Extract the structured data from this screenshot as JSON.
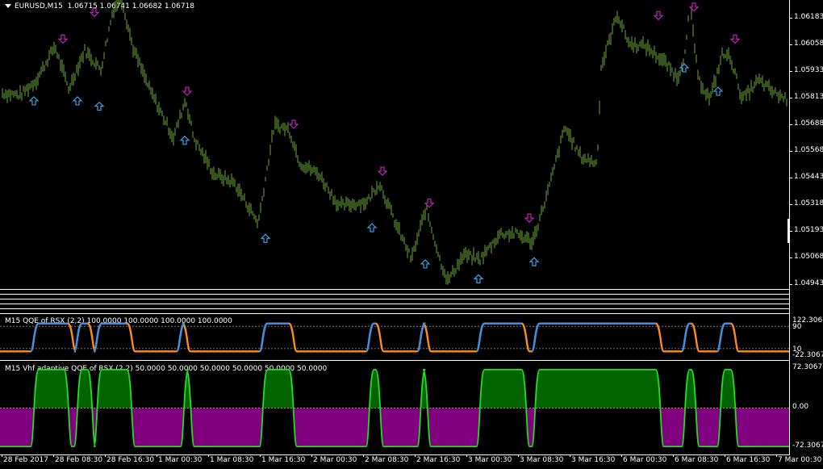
{
  "main": {
    "symbol": "EURUSD,M15",
    "ohlc": "1.06715 1.06741 1.06682 1.06718",
    "price_ticks": [
      "1.06183",
      "1.06058",
      "1.05933",
      "1.05813",
      "1.05688",
      "1.05568",
      "1.05443",
      "1.05318",
      "1.05193",
      "1.05068",
      "1.04943"
    ]
  },
  "qqe": {
    "title": "M15 QQE of RSX (2,2) 100.0000 100.0000 100.0000 100.0000",
    "scale_top": "122.3067",
    "level_hi": "90",
    "level_lo": "10",
    "scale_bottom": "-22.3067"
  },
  "vhf": {
    "title": "M15 Vhf adaptive QQE of RSX (2,2) 50.0000 50.0000 50.0000 50.0000 50.0000 50.0000",
    "scale_top": "72.3067",
    "level_mid": "0.00",
    "scale_bottom": "-72.3067"
  },
  "time_ticks": [
    "28 Feb 2017",
    "28 Feb 08:30",
    "28 Feb 16:30",
    "1 Mar 00:30",
    "1 Mar 08:30",
    "1 Mar 16:30",
    "2 Mar 00:30",
    "2 Mar 08:30",
    "2 Mar 16:30",
    "3 Mar 00:30",
    "3 Mar 08:30",
    "3 Mar 16:30",
    "6 Mar 00:30",
    "6 Mar 08:30",
    "6 Mar 16:30",
    "7 Mar 00:30"
  ],
  "colors": {
    "bars": "#6fa83a",
    "up_arrow": "#3ca0e6",
    "down_arrow": "#c020c0",
    "qqe_blue": "#3a8fe8",
    "qqe_orange": "#ff8c1a",
    "vhf_line": "#22dd22",
    "vhf_pos": "#006400",
    "vhf_neg": "#800080",
    "level_line": "#c8b860"
  },
  "chart_data": [
    {
      "type": "bar",
      "name": "EURUSD M15 price",
      "x": [
        "28 Feb 2017",
        "28 Feb 08:30",
        "28 Feb 16:30",
        "1 Mar 00:30",
        "1 Mar 08:30",
        "1 Mar 16:30",
        "2 Mar 00:30",
        "2 Mar 08:30",
        "2 Mar 16:30",
        "3 Mar 00:30",
        "3 Mar 08:30",
        "3 Mar 16:30",
        "6 Mar 00:30",
        "6 Mar 08:30",
        "6 Mar 16:30",
        "7 Mar 00:30"
      ],
      "close": [
        1.0583,
        1.0595,
        1.0622,
        1.0567,
        1.054,
        1.0564,
        1.0535,
        1.053,
        1.0504,
        1.051,
        1.0521,
        1.0567,
        1.0612,
        1.0604,
        1.06,
        1.0583
      ],
      "ylim": [
        1.0492,
        1.0624
      ]
    },
    {
      "type": "line",
      "name": "QQE of RSX",
      "ylim": [
        -22.3067,
        122.3067
      ],
      "levels": [
        10,
        90
      ],
      "segments_high": [
        [
          0.045,
          0.09
        ],
        [
          0.1,
          0.115
        ],
        [
          0.125,
          0.165
        ],
        [
          0.23,
          0.235
        ],
        [
          0.335,
          0.37
        ],
        [
          0.47,
          0.48
        ],
        [
          0.535,
          0.54
        ],
        [
          0.61,
          0.665
        ],
        [
          0.68,
          0.835
        ],
        [
          0.87,
          0.88
        ],
        [
          0.915,
          0.93
        ]
      ]
    },
    {
      "type": "area",
      "name": "Vhf adaptive QQE of RSX",
      "ylim": [
        -72.3067,
        72.3067
      ],
      "levels": [
        0
      ],
      "segments_high": [
        [
          0.045,
          0.085
        ],
        [
          0.1,
          0.115
        ],
        [
          0.125,
          0.165
        ],
        [
          0.235,
          0.24
        ],
        [
          0.335,
          0.37
        ],
        [
          0.47,
          0.48
        ],
        [
          0.535,
          0.54
        ],
        [
          0.61,
          0.665
        ],
        [
          0.68,
          0.835
        ],
        [
          0.87,
          0.88
        ],
        [
          0.915,
          0.93
        ]
      ]
    }
  ]
}
